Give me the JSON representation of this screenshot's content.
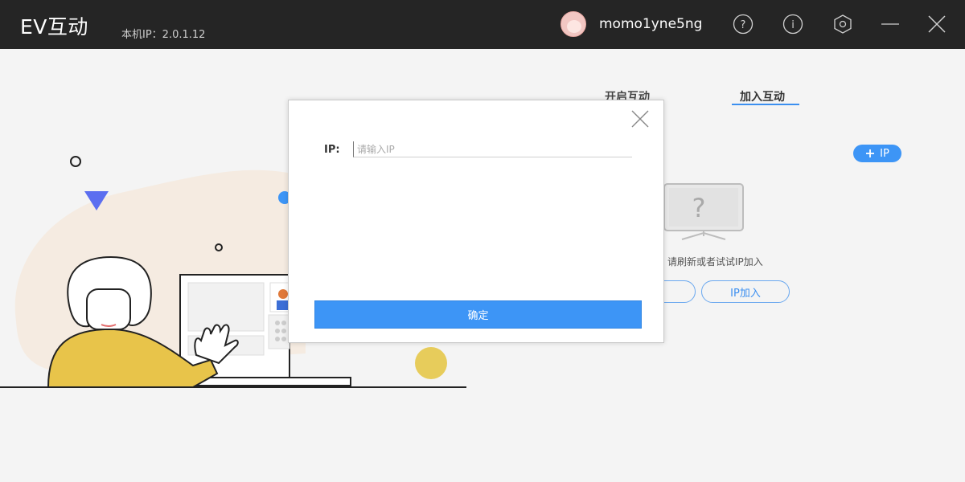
{
  "titlebar": {
    "app_title": "EV互动",
    "local_ip": "本机IP：2.0.1.12",
    "username": "momo1yne5ng",
    "icons": [
      "help-icon",
      "info-icon",
      "settings-icon",
      "minimize-icon",
      "close-icon"
    ]
  },
  "tabs": [
    {
      "label": "开启互动",
      "active": false
    },
    {
      "label": "加入互动",
      "active": true
    }
  ],
  "main": {
    "add_ip_label": "IP",
    "hint": "备，请刷新或者试试IP加入",
    "monitor_symbol": "?",
    "refresh_label": "",
    "ip_join_label": "IP加入"
  },
  "dialog": {
    "ip_label": "IP:",
    "ip_placeholder": "请输入IP",
    "ip_value": "",
    "confirm_label": "确定"
  },
  "colors": {
    "titlebar": "#252525",
    "accent": "#3d95f6",
    "background": "#f4f4f4"
  }
}
